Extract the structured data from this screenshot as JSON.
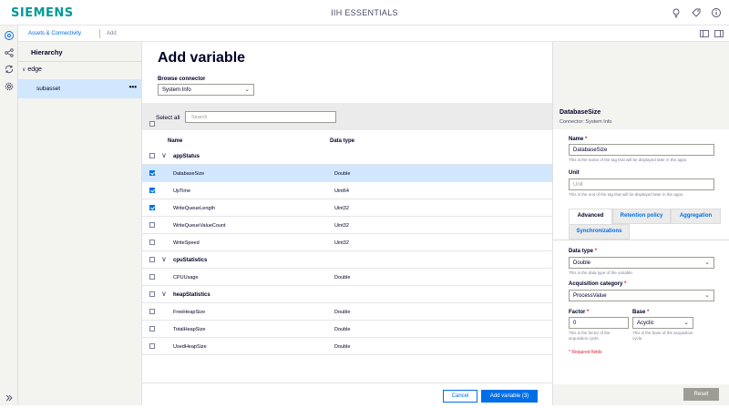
{
  "header": {
    "brand": "SIEMENS",
    "app_title": "IIH ESSENTIALS",
    "icons": [
      "lightbulb-icon",
      "tag-icon",
      "info-icon"
    ]
  },
  "breadcrumb": {
    "link": "Assets & Connectivity",
    "current": "Add"
  },
  "hierarchy": {
    "title": "Hierarchy",
    "root": "edge",
    "selected": "subasset",
    "more": "•••"
  },
  "main": {
    "title": "Add variable",
    "connector_label": "Browse connector",
    "connector_value": "System Info",
    "select_all": "Select all",
    "search_placeholder": "Search",
    "col_name": "Name",
    "col_type": "Data type",
    "rows": [
      {
        "group": true,
        "name": "appStatus",
        "type": ""
      },
      {
        "name": "DatabaseSize",
        "type": "Double",
        "checked": true,
        "selected": true
      },
      {
        "name": "UpTime",
        "type": "Uint64",
        "checked": true
      },
      {
        "name": "WriteQueueLength",
        "type": "Uint32",
        "checked": true
      },
      {
        "name": "WriteQueueValueCount",
        "type": "Uint32",
        "checked": false
      },
      {
        "name": "WriteSpeed",
        "type": "Uint32",
        "checked": false
      },
      {
        "group": true,
        "name": "cpuStatistics",
        "type": ""
      },
      {
        "name": "CPUUsage",
        "type": "Double",
        "checked": false
      },
      {
        "group": true,
        "name": "heapStatistics",
        "type": ""
      },
      {
        "name": "FreeHeapSize",
        "type": "Double",
        "checked": false
      },
      {
        "name": "TotalHeapSize",
        "type": "Double",
        "checked": false
      },
      {
        "name": "UsedHeapSize",
        "type": "Double",
        "checked": false
      }
    ],
    "cancel": "Cancel",
    "add": "Add variable (3)"
  },
  "details": {
    "title": "DatabaseSize",
    "connector": "Connector: System Info",
    "name_label": "Name",
    "name_value": "DatabaseSize",
    "name_hint": "This is the name of the tag that will be displayed later in the apps.",
    "unit_label": "Unit",
    "unit_placeholder": "Unit",
    "unit_hint": "This is the unit of the tag that will be displayed later in the apps.",
    "tabs": [
      "Advanced",
      "Retention policy",
      "Aggregation",
      "Synchronizations"
    ],
    "datatype_label": "Data type",
    "datatype_value": "Double",
    "datatype_hint": "This is the data type of the variable.",
    "acq_label": "Acquisition category",
    "acq_value": "ProcessValue",
    "factor_label": "Factor",
    "factor_value": "0",
    "factor_hint": "This is the factor of the acquisition cycle.",
    "base_label": "Base",
    "base_value": "Acyclic",
    "base_hint": "This is the base of the acquisition cycle.",
    "required": "* Required fields",
    "reset": "Reset"
  },
  "colors": {
    "accent": "#006fe6",
    "brand": "#009999",
    "selection": "#d1e7fe"
  }
}
